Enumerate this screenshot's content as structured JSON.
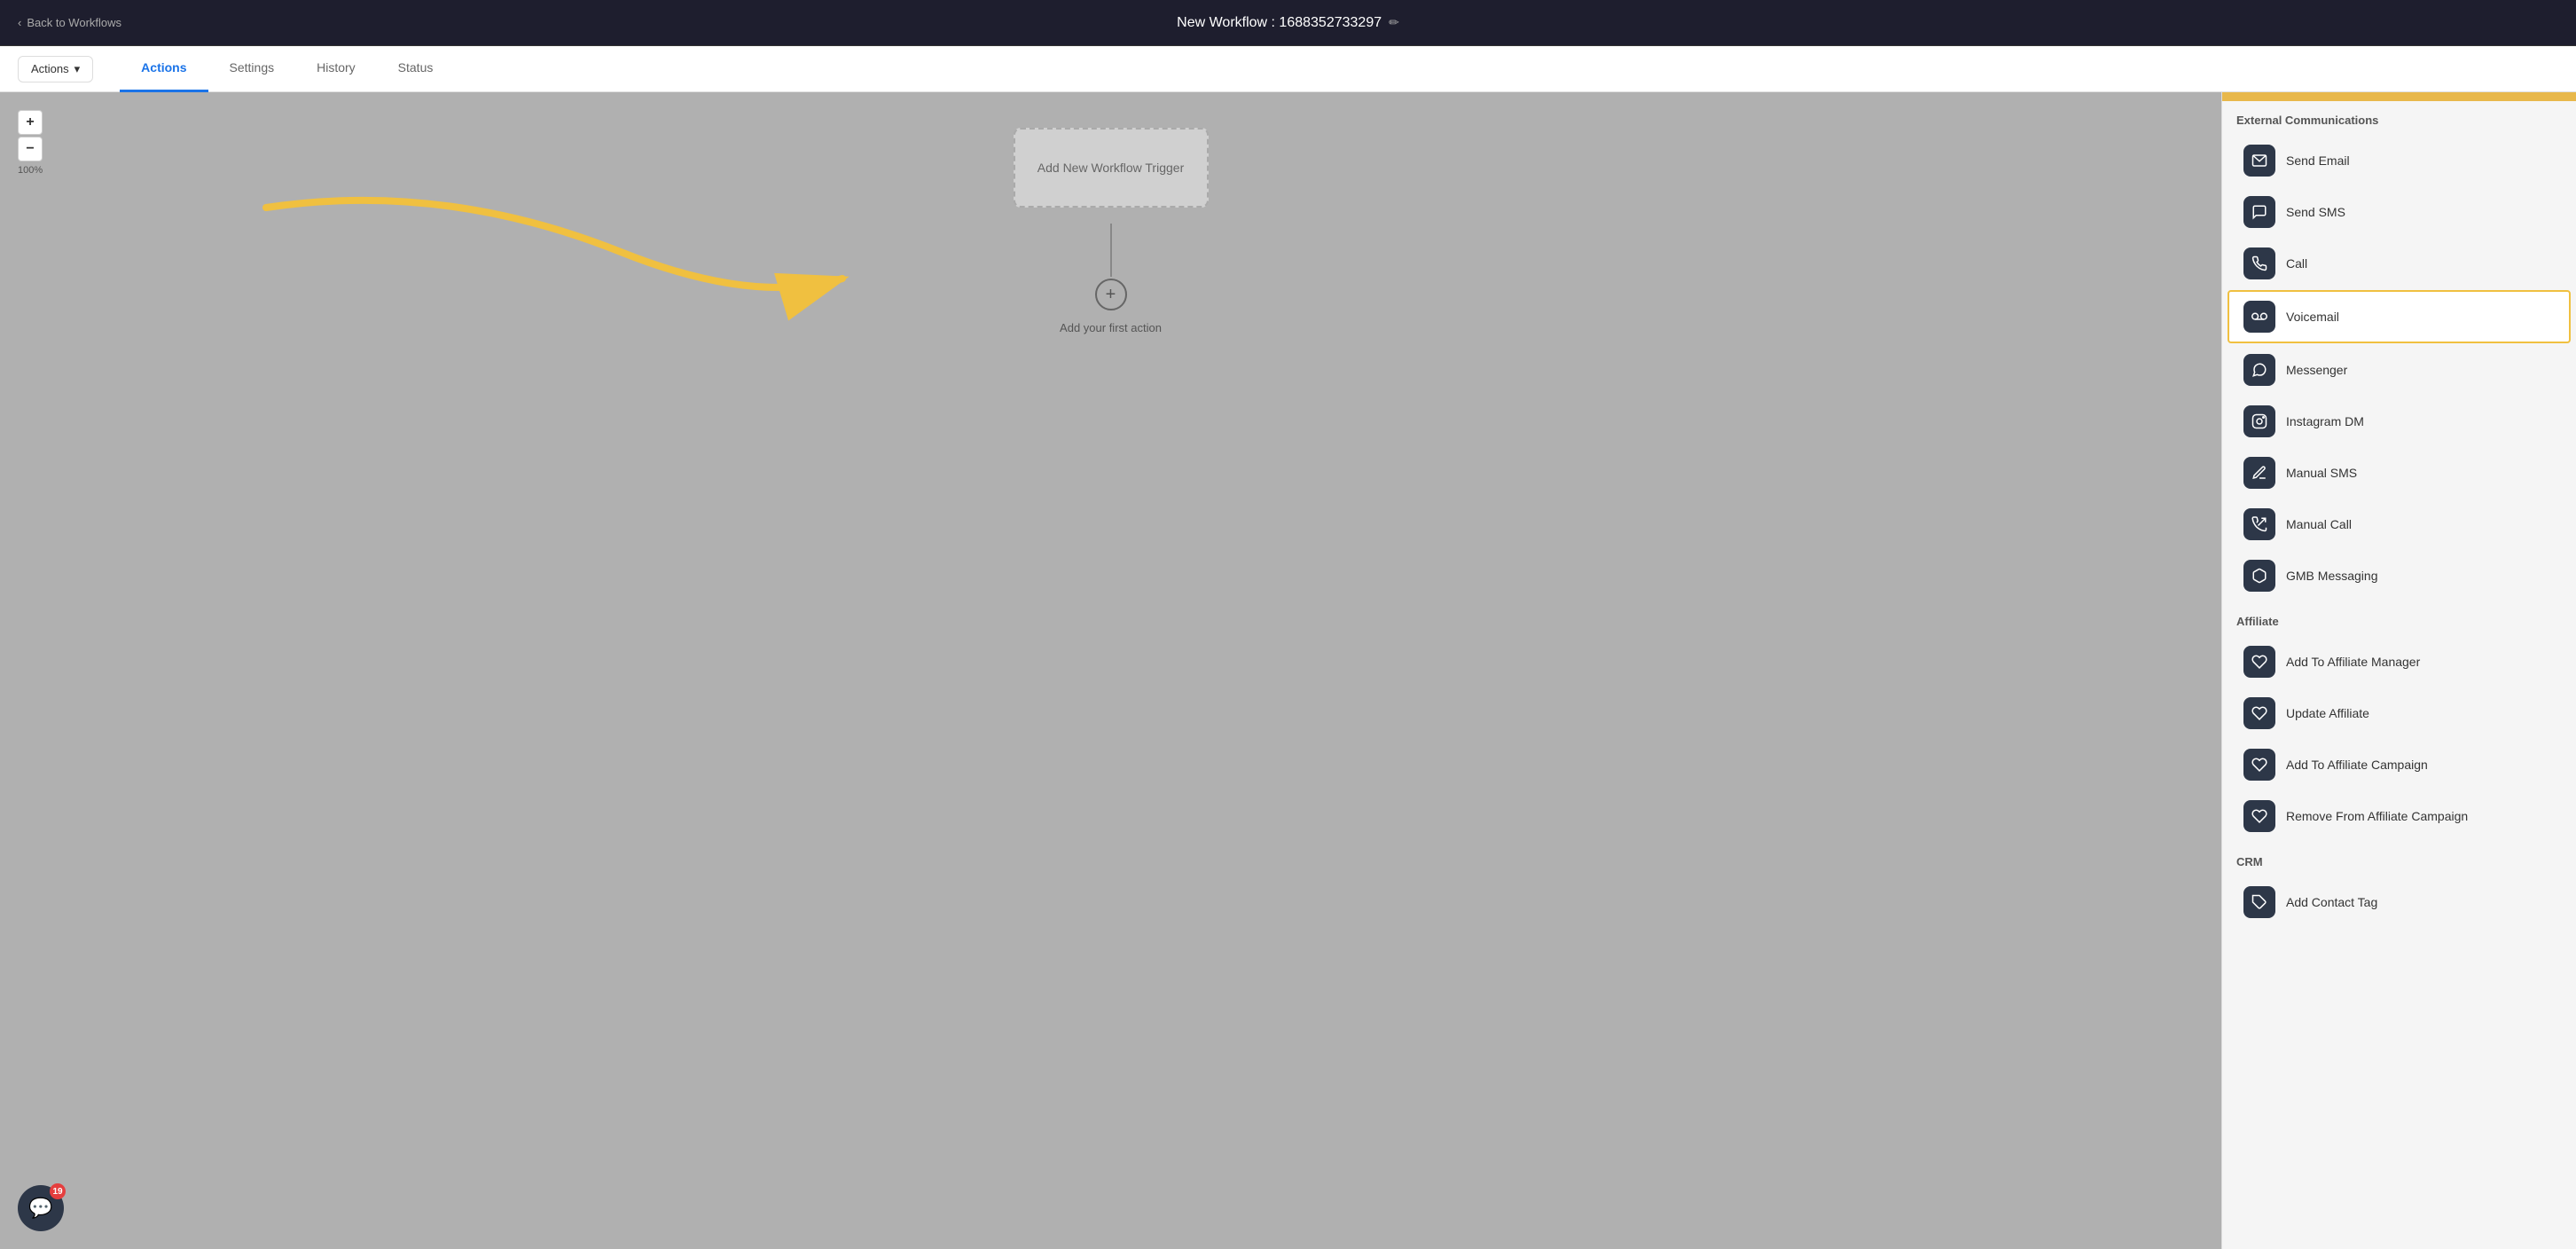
{
  "topNav": {
    "back_label": "Back to Workflows",
    "workflow_title": "New Workflow : 1688352733297",
    "edit_icon": "✏"
  },
  "tabs": {
    "actions_dropdown_label": "Actions",
    "tabs_list": [
      {
        "id": "actions",
        "label": "Actions",
        "active": true
      },
      {
        "id": "settings",
        "label": "Settings",
        "active": false
      },
      {
        "id": "history",
        "label": "History",
        "active": false
      },
      {
        "id": "status",
        "label": "Status",
        "active": false
      }
    ]
  },
  "canvas": {
    "zoom_in_label": "+",
    "zoom_out_label": "−",
    "zoom_percent": "100%",
    "trigger_box_label": "Add New Workflow Trigger",
    "add_action_label": "Add your first action"
  },
  "sidebar": {
    "sections": [
      {
        "id": "external-communications",
        "title": "External Communications",
        "items": [
          {
            "id": "send-email",
            "label": "Send Email",
            "icon": "✉",
            "highlighted": false
          },
          {
            "id": "send-sms",
            "label": "Send SMS",
            "icon": "💬",
            "highlighted": false
          },
          {
            "id": "call",
            "label": "Call",
            "icon": "📞",
            "highlighted": false
          },
          {
            "id": "voicemail",
            "label": "Voicemail",
            "icon": "📼",
            "highlighted": true
          },
          {
            "id": "messenger",
            "label": "Messenger",
            "icon": "🔄",
            "highlighted": false
          },
          {
            "id": "instagram-dm",
            "label": "Instagram DM",
            "icon": "📷",
            "highlighted": false
          },
          {
            "id": "manual-sms",
            "label": "Manual SMS",
            "icon": "✏",
            "highlighted": false
          },
          {
            "id": "manual-call",
            "label": "Manual Call",
            "icon": "📞",
            "highlighted": false
          },
          {
            "id": "gmb-messaging",
            "label": "GMB Messaging",
            "icon": "💼",
            "highlighted": false
          }
        ]
      },
      {
        "id": "affiliate",
        "title": "Affiliate",
        "items": [
          {
            "id": "add-affiliate-manager",
            "label": "Add To Affiliate Manager",
            "icon": "🏷",
            "highlighted": false
          },
          {
            "id": "update-affiliate",
            "label": "Update Affiliate",
            "icon": "🏷",
            "highlighted": false
          },
          {
            "id": "add-affiliate-campaign",
            "label": "Add To Affiliate Campaign",
            "icon": "🏷",
            "highlighted": false
          },
          {
            "id": "remove-affiliate-campaign",
            "label": "Remove From Affiliate Campaign",
            "icon": "🏷",
            "highlighted": false
          }
        ]
      },
      {
        "id": "crm",
        "title": "CRM",
        "items": [
          {
            "id": "add-contact-tag",
            "label": "Add Contact Tag",
            "icon": "🏷",
            "highlighted": false
          }
        ]
      }
    ]
  },
  "chatWidget": {
    "badge_count": "19"
  }
}
